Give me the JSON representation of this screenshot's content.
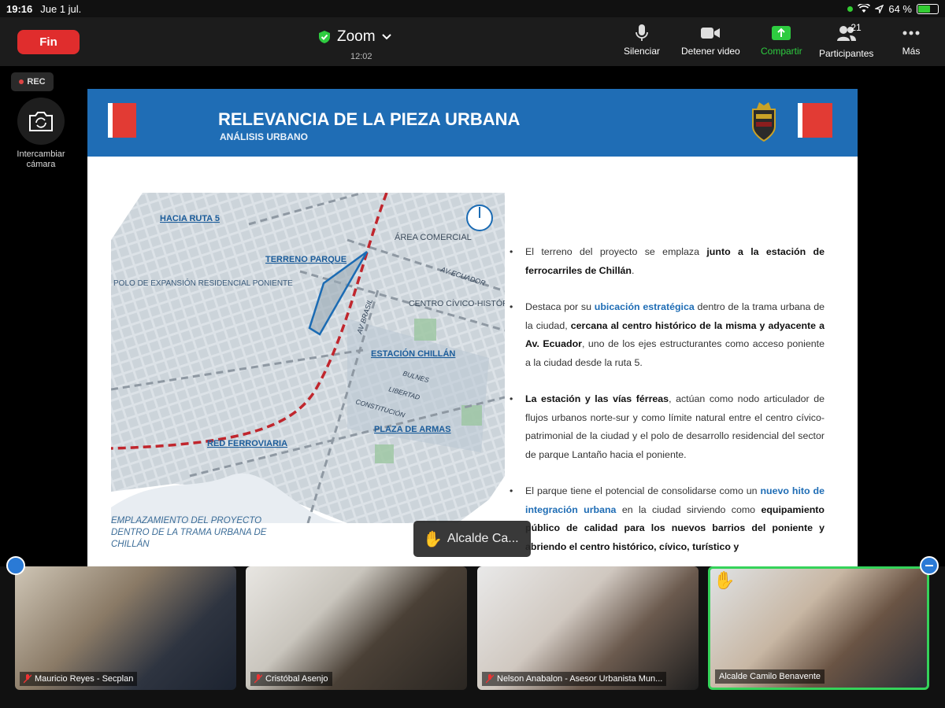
{
  "status": {
    "time": "19:16",
    "date": "Jue 1 jul.",
    "battery": "64 %",
    "battery_level": 0.64
  },
  "meeting": {
    "end_label": "Fin",
    "app_title": "Zoom",
    "timer": "12:02",
    "rec_label": "REC",
    "switch_camera_label": "Intercambiar cámara",
    "toolbar": {
      "mute": "Silenciar",
      "stop_video": "Detener video",
      "share": "Compartir",
      "participants": "Participantes",
      "participants_count": "21",
      "more": "Más"
    }
  },
  "slide": {
    "title": "RELEVANCIA DE LA PIEZA URBANA",
    "subtitle": "ANÁLISIS URBANO",
    "map_labels": {
      "ruta5": "HACIA RUTA 5",
      "area_comercial": "ÁREA COMERCIAL",
      "terreno": "TERRENO PARQUE",
      "av_ecuador": "AV ECUADOR",
      "polo": "POLO DE EXPANSIÓN RESIDENCIAL PONIENTE",
      "centro": "CENTRO CÍVICO-HISTÓRICO",
      "av_brasil": "AV BRASIL",
      "estacion": "ESTACIÓN CHILLÁN",
      "bulnes": "BULNES",
      "libertad": "LIBERTAD",
      "constitucion": "CONSTITUCIÓN",
      "plaza": "PLAZA DE ARMAS",
      "red": "RED FERROVIARIA"
    },
    "caption": "EMPLAZAMIENTO DEL PROYECTO DENTRO DE LA TRAMA URBANA DE CHILLÁN",
    "bullets": [
      [
        "El terreno del proyecto se emplaza ",
        "junto a la estación de ferrocarriles de Chillán",
        "."
      ],
      [
        "Destaca por su ",
        "ubicación estratégica",
        " dentro de la trama urbana de la ciudad, ",
        "cercana al centro histórico de la misma y adyacente a Av. Ecuador",
        ", uno de los ejes estructurantes como acceso poniente a la ciudad desde la ruta 5."
      ],
      [
        "",
        "La estación y las vías férreas",
        ", actúan como nodo articulador de flujos urbanos norte-sur y como límite natural entre el centro cívico-patrimonial de la ciudad y el polo de desarrollo residencial del sector de parque Lantaño hacia el poniente."
      ],
      [
        "El parque tiene el potencial de consolidarse como un ",
        "nuevo hito de integración urbana",
        " en la ciudad sirviendo como ",
        "equipamiento público de calidad para los nuevos barrios del poniente y abriendo el centro histórico, cívico, turístico y"
      ]
    ]
  },
  "raised_hand": {
    "name": "Alcalde Ca..."
  },
  "participants": [
    {
      "name": "Mauricio Reyes - Secplan",
      "muted": true
    },
    {
      "name": "Cristóbal Asenjo",
      "muted": true
    },
    {
      "name": "Nelson Anabalon - Asesor Urbanista Mun...",
      "muted": true
    },
    {
      "name": "Alcalde Camilo Benavente",
      "muted": false,
      "active": true
    }
  ]
}
